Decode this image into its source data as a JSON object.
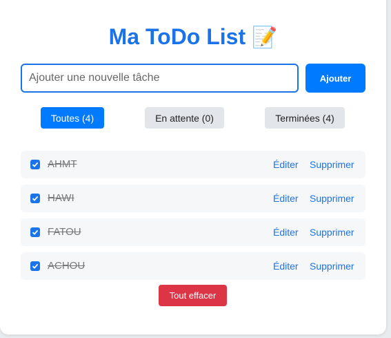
{
  "app": {
    "title": "Ma ToDo List",
    "title_emoji": "📝"
  },
  "new_task": {
    "placeholder": "Ajouter une nouvelle tâche",
    "value": "",
    "add_label": "Ajouter"
  },
  "filters": [
    {
      "label": "Toutes (4)",
      "active": true
    },
    {
      "label": "En attente (0)",
      "active": false
    },
    {
      "label": "Terminées (4)",
      "active": false
    }
  ],
  "tasks": [
    {
      "text": "AHMT",
      "done": true,
      "edit_label": "Éditer",
      "delete_label": "Supprimer"
    },
    {
      "text": "HAWI",
      "done": true,
      "edit_label": "Éditer",
      "delete_label": "Supprimer"
    },
    {
      "text": "FATOU",
      "done": true,
      "edit_label": "Éditer",
      "delete_label": "Supprimer"
    },
    {
      "text": "ACHOU",
      "done": true,
      "edit_label": "Éditer",
      "delete_label": "Supprimer"
    }
  ],
  "clear_all_label": "Tout effacer",
  "colors": {
    "accent": "#007bff",
    "title": "#1a73e8",
    "danger": "#dc3545",
    "filter_inactive": "#e2e6ea",
    "task_bg": "#f6f7f9"
  }
}
